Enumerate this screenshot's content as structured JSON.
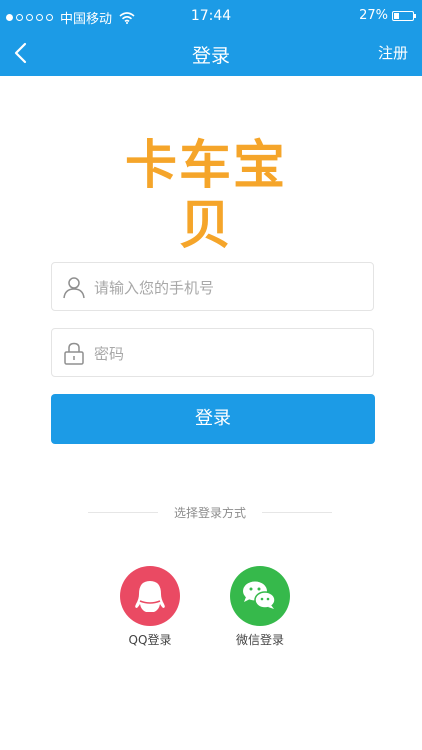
{
  "status_bar": {
    "carrier": "中国移动",
    "time": "17:44",
    "battery_percent_text": "27%",
    "battery_level": 0.27,
    "signal_dots_filled": 1
  },
  "nav": {
    "title": "登录",
    "register_label": "注册"
  },
  "logo": {
    "text": "卡车宝贝",
    "color": "#f5a52a"
  },
  "form": {
    "phone_placeholder": "请输入您的手机号",
    "phone_value": "",
    "password_placeholder": "密码",
    "password_value": "",
    "login_label": "登录"
  },
  "login_methods": {
    "title": "选择登录方式",
    "qq_label": "QQ登录",
    "wechat_label": "微信登录"
  },
  "colors": {
    "primary": "#1c9be6",
    "qq": "#ea4a63",
    "wechat": "#36b94b"
  }
}
